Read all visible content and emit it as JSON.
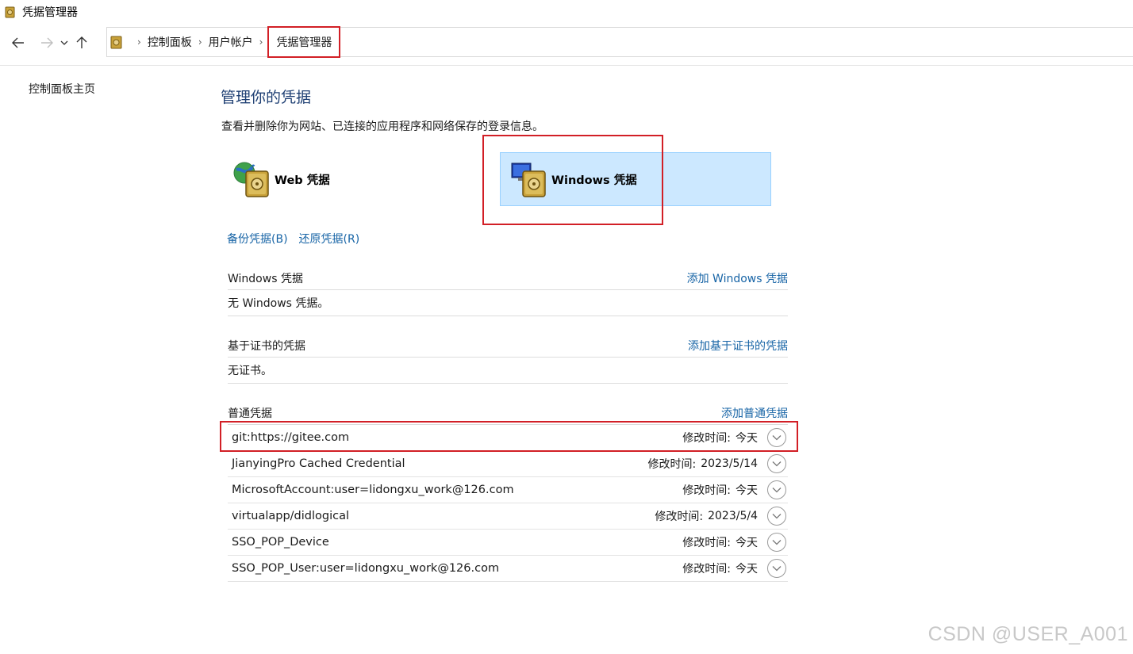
{
  "window": {
    "title": "凭据管理器",
    "app_icon": "credential-manager-icon"
  },
  "nav": {
    "back_icon": "arrow-left-icon",
    "forward_icon": "arrow-right-icon",
    "recent_icon": "chevron-down-icon",
    "up_icon": "arrow-up-icon"
  },
  "breadcrumb": {
    "items": [
      "控制面板",
      "用户帐户",
      "凭据管理器"
    ],
    "separator": "›"
  },
  "sidebar": {
    "home_link": "控制面板主页"
  },
  "main": {
    "title": "管理你的凭据",
    "description": "查看并删除你为网站、已连接的应用程序和网络保存的登录信息。",
    "types": {
      "web_label": "Web 凭据",
      "windows_label": "Windows 凭据",
      "selected": "Windows 凭据"
    },
    "backup_link": "备份凭据(B)",
    "restore_link": "还原凭据(R)"
  },
  "sections": {
    "windows": {
      "header": "Windows 凭据",
      "add_link": "添加 Windows 凭据",
      "empty_text": "无 Windows 凭据。"
    },
    "certificate": {
      "header": "基于证书的凭据",
      "add_link": "添加基于证书的凭据",
      "empty_text": "无证书。"
    },
    "generic": {
      "header": "普通凭据",
      "add_link": "添加普通凭据",
      "modified_label": "修改时间:",
      "rows": [
        {
          "name": "git:https://gitee.com",
          "modified": "今天"
        },
        {
          "name": "JianyingPro Cached Credential",
          "modified": "2023/5/14"
        },
        {
          "name": "MicrosoftAccount:user=lidongxu_work@126.com",
          "modified": "今天"
        },
        {
          "name": "virtualapp/didlogical",
          "modified": "2023/5/4"
        },
        {
          "name": "SSO_POP_Device",
          "modified": "今天"
        },
        {
          "name": "SSO_POP_User:user=lidongxu_work@126.com",
          "modified": "今天"
        }
      ]
    }
  },
  "colors": {
    "link": "#1764a6",
    "title": "#1e3f73",
    "highlight_box": "#d21f26",
    "selected_bg": "#cce8ff"
  },
  "watermark": "CSDN @USER_A001"
}
